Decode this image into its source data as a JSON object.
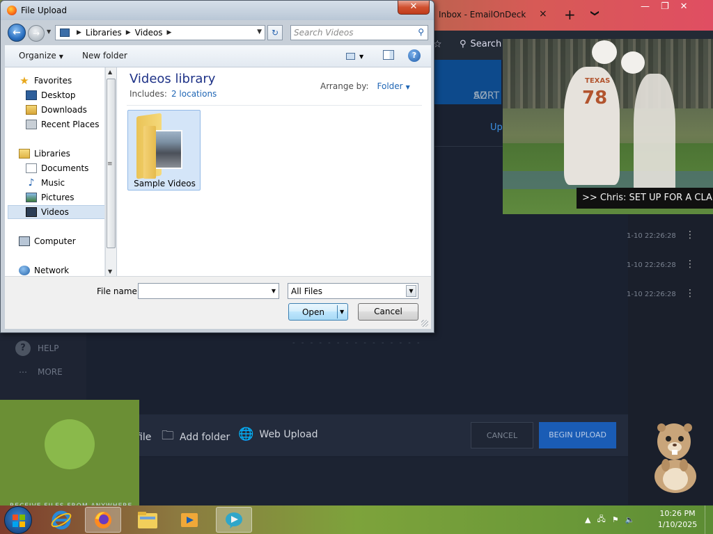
{
  "browser": {
    "tab_title": "Inbox - EmailOnDeck",
    "tab_close": "×",
    "new_tab": "+",
    "tab_list": "❯",
    "window_buttons": [
      "—",
      "❐",
      "✕"
    ],
    "search_label": "Search"
  },
  "app": {
    "sort_label": "SORT",
    "sort_icon": "AZ",
    "up_link": "Up",
    "dates": [
      "1-10 22:26:28",
      "1-10 22:26:28",
      "1-10 22:26:28"
    ],
    "nav": [
      {
        "label": "HELP",
        "icon": "?"
      },
      {
        "label": "MORE",
        "icon": "⋯"
      }
    ],
    "footer": {
      "add_file": "Add file",
      "add_folder": "Add folder",
      "web_upload": "Web Upload",
      "cancel": "CANCEL",
      "begin_upload": "BEGIN UPLOAD"
    },
    "green_panel_caption": "RECEIVE FILES FROM ANYWHERE"
  },
  "video": {
    "caption": ">> Chris: SET UP FOR A CLA",
    "jersey_number": "78",
    "jersey_text": "TEXAS"
  },
  "dialog": {
    "title": "File Upload",
    "close": "✕",
    "breadcrumb": [
      "Libraries",
      "Videos"
    ],
    "search_placeholder": "Search Videos",
    "toolbar": {
      "organize": "Organize",
      "new_folder": "New folder"
    },
    "nav_pane": {
      "favorites": {
        "label": "Favorites",
        "items": [
          "Desktop",
          "Downloads",
          "Recent Places"
        ]
      },
      "libraries": {
        "label": "Libraries",
        "items": [
          "Documents",
          "Music",
          "Pictures",
          "Videos"
        ]
      },
      "computer": "Computer",
      "network": "Network",
      "selected": "Videos"
    },
    "content": {
      "title": "Videos library",
      "includes_label": "Includes:",
      "includes_link": "2 locations",
      "arrange_label": "Arrange by:",
      "arrange_value": "Folder",
      "items": [
        {
          "name": "Sample Videos"
        }
      ]
    },
    "file_name_label": "File name:",
    "file_name_value": "",
    "file_type": "All Files",
    "open_label": "Open",
    "cancel_label": "Cancel"
  },
  "taskbar": {
    "time": "10:26 PM",
    "date": "1/10/2025"
  }
}
